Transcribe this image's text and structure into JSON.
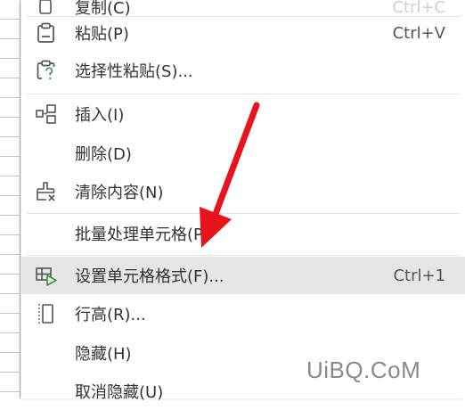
{
  "menu": {
    "items": [
      {
        "label": "复制(C)",
        "shortcut": "Ctrl+C",
        "icon": "copy-icon"
      },
      {
        "label": "粘贴(P)",
        "shortcut": "Ctrl+V",
        "icon": "paste-icon"
      },
      {
        "label": "选择性粘贴(S)...",
        "shortcut": "",
        "icon": "paste-special-icon"
      },
      {
        "label": "插入(I)",
        "shortcut": "",
        "icon": "insert-icon"
      },
      {
        "label": "删除(D)",
        "shortcut": "",
        "icon": ""
      },
      {
        "label": "清除内容(N)",
        "shortcut": "",
        "icon": "eraser-icon"
      },
      {
        "label": "批量处理单元格(P)",
        "shortcut": "",
        "icon": ""
      },
      {
        "label": "设置单元格格式(F)...",
        "shortcut": "Ctrl+1",
        "icon": "format-cells-icon"
      },
      {
        "label": "行高(R)...",
        "shortcut": "",
        "icon": "row-height-icon"
      },
      {
        "label": "隐藏(H)",
        "shortcut": "",
        "icon": ""
      },
      {
        "label": "取消隐藏(U)",
        "shortcut": "",
        "icon": ""
      }
    ],
    "hovered_index": 7
  },
  "watermark": {
    "text": "UiBQ.CoM"
  },
  "colors": {
    "arrow": "#e8141b",
    "hover": "#e6e6e6",
    "icon_green": "#3a9a4a"
  }
}
